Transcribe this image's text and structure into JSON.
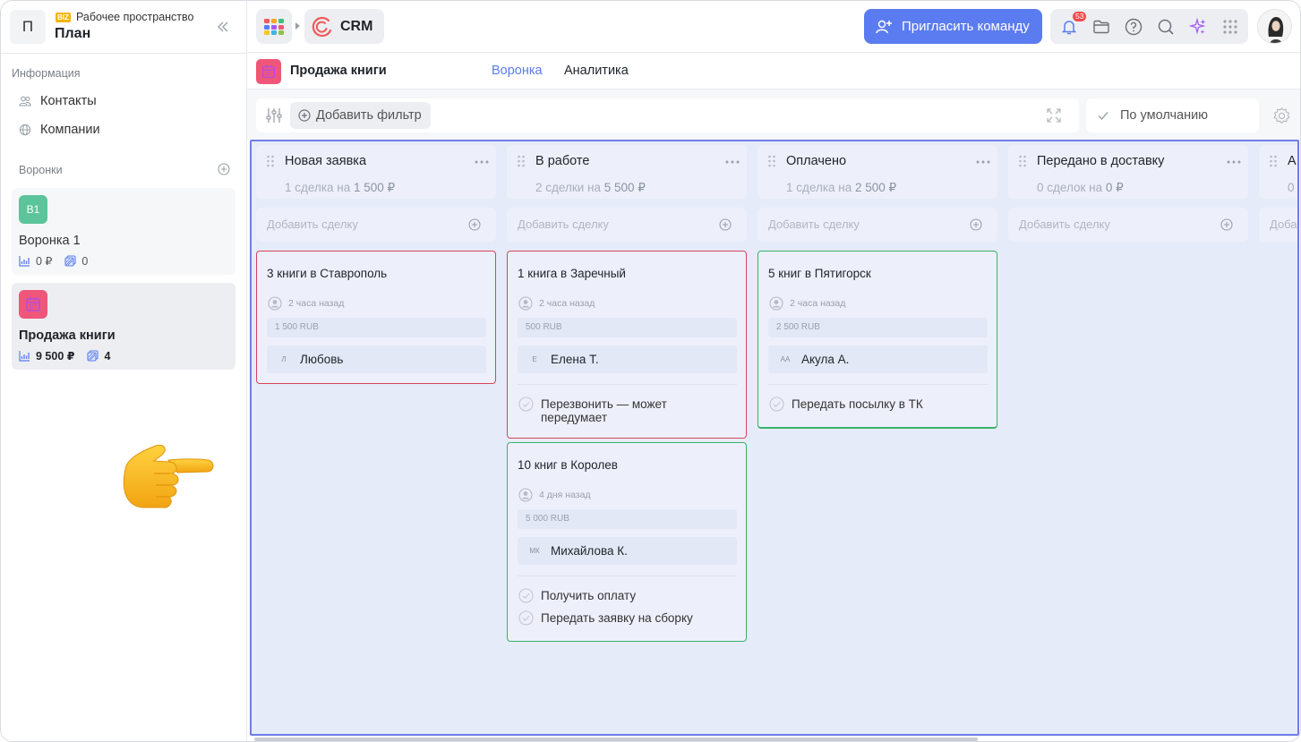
{
  "workspace": {
    "initial": "П",
    "badge": "BIZ",
    "caption": "Рабочее пространство",
    "name": "План"
  },
  "sidebar": {
    "info_label": "Информация",
    "items": [
      {
        "label": "Контакты",
        "icon": "contacts-icon"
      },
      {
        "label": "Компании",
        "icon": "globe-icon"
      }
    ],
    "funnels_label": "Воронки",
    "funnels": [
      {
        "badge": "В1",
        "title": "Воронка 1",
        "amount": "0 ₽",
        "count": "0",
        "color": "#5cc49a"
      },
      {
        "badge": "",
        "title": "Продажа книги",
        "amount": "9 500 ₽",
        "count": "4",
        "color": "#f0567a"
      }
    ]
  },
  "topbar": {
    "app_name": "CRM",
    "invite_label": "Пригласить команду",
    "notifications_count": "53"
  },
  "page": {
    "title": "Продажа книги",
    "tabs": [
      {
        "label": "Воронка",
        "active": true
      },
      {
        "label": "Аналитика",
        "active": false
      }
    ]
  },
  "filters": {
    "add_label": "Добавить фильтр",
    "view_label": "По умолчанию"
  },
  "board": {
    "add_deal_label": "Добавить сделку",
    "columns": [
      {
        "title": "Новая заявка",
        "summary_prefix": "1 сделка на",
        "summary_amount": "1 500 ₽"
      },
      {
        "title": "В работе",
        "summary_prefix": "2 сделки на",
        "summary_amount": "5 500 ₽"
      },
      {
        "title": "Оплачено",
        "summary_prefix": "1 сделка на",
        "summary_amount": "2 500 ₽"
      },
      {
        "title": "Передано в доставку",
        "summary_prefix": "0 сделок на",
        "summary_amount": "0 ₽"
      },
      {
        "title": "А",
        "summary_prefix": "0",
        "summary_amount": ""
      }
    ],
    "partial_add_label": "Доба",
    "cards": [
      {
        "title": "3 книги в Ставрополь",
        "time": "2 часа назад",
        "price": "1 500 RUB",
        "initials": "Л",
        "person": "Любовь",
        "tasks": []
      },
      {
        "title": "1 книга в Заречный",
        "time": "2 часа назад",
        "price": "500 RUB",
        "initials": "Е",
        "person": "Елена Т.",
        "tasks": [
          "Перезвонить — может передумает"
        ]
      },
      {
        "title": "10 книг в Королев",
        "time": "4 дня назад",
        "price": "5 000 RUB",
        "initials": "МК",
        "person": "Михайлова К.",
        "tasks": [
          "Получить оплату",
          "Передать заявку на сборку"
        ]
      },
      {
        "title": "5 книг в Пятигорск",
        "time": "2 часа назад",
        "price": "2 500 RUB",
        "initials": "АА",
        "person": "Акула А.",
        "tasks": [
          "Передать посылку в ТК"
        ]
      }
    ]
  },
  "colors": {
    "accent": "#5b7cf0",
    "card_red": "#d6455c",
    "card_green": "#38b26a",
    "board_bg": "#e6ebf9"
  }
}
